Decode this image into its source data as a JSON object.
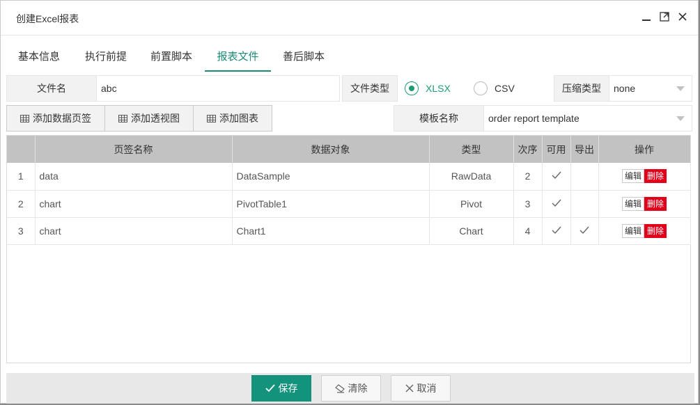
{
  "dialog": {
    "title": "创建Excel报表"
  },
  "tabs": [
    {
      "label": "基本信息"
    },
    {
      "label": "执行前提"
    },
    {
      "label": "前置脚本"
    },
    {
      "label": "报表文件",
      "active": true
    },
    {
      "label": "善后脚本"
    }
  ],
  "file": {
    "name_label": "文件名",
    "name_value": "abc",
    "type_label": "文件类型",
    "type_options": [
      "XLSX",
      "CSV"
    ],
    "type_selected": "XLSX",
    "compress_label": "压缩类型",
    "compress_value": "none"
  },
  "toolbar": {
    "add_sheet": "添加数据页签",
    "add_pivot": "添加透视图",
    "add_chart": "添加图表",
    "template_label": "模板名称",
    "template_value": "order report template"
  },
  "table": {
    "headers": [
      "",
      "页签名称",
      "数据对象",
      "类型",
      "次序",
      "可用",
      "导出",
      "操作"
    ],
    "rows": [
      {
        "num": "1",
        "sheet": "data",
        "object": "DataSample",
        "type": "RawData",
        "order": "2",
        "enabled": true,
        "export": false
      },
      {
        "num": "2",
        "sheet": "chart",
        "object": "PivotTable1",
        "type": "Pivot",
        "order": "3",
        "enabled": true,
        "export": false
      },
      {
        "num": "3",
        "sheet": "chart",
        "object": "Chart1",
        "type": "Chart",
        "order": "4",
        "enabled": true,
        "export": true
      }
    ],
    "edit_label": "编辑",
    "delete_label": "删除"
  },
  "footer": {
    "save": "保存",
    "clear": "清除",
    "cancel": "取消"
  },
  "colors": {
    "accent": "#1c8a78",
    "primary_button": "#13937c",
    "radio_on": "#1c9c6e",
    "delete": "#e0001b",
    "header_bg": "#c2c2c2"
  }
}
